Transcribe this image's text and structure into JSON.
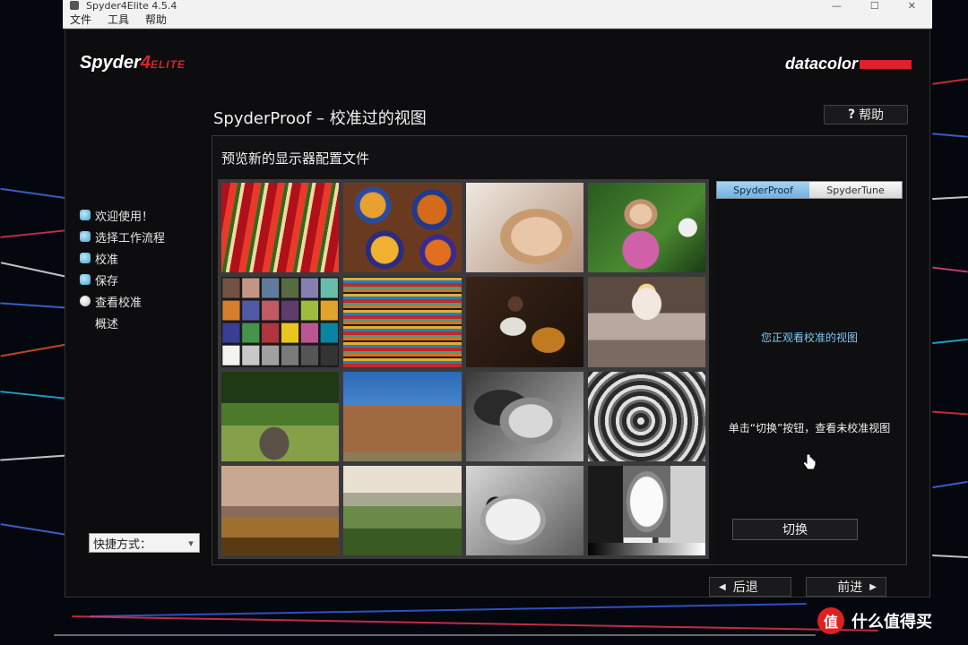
{
  "os": {
    "title": "Spyder4Elite 4.5.4",
    "menu": [
      "文件",
      "工具",
      "帮助"
    ]
  },
  "brand": {
    "product_main": "Spyder",
    "product_num": "4",
    "product_edition": "ELITE",
    "vendor": "datacolor"
  },
  "header": {
    "title": "SpyderProof – 校准过的视图",
    "help_label": "帮助"
  },
  "nav": {
    "items": [
      {
        "label": "欢迎使用！",
        "state": "done"
      },
      {
        "label": "选择工作流程",
        "state": "done"
      },
      {
        "label": "校准",
        "state": "done"
      },
      {
        "label": "保存",
        "state": "done"
      },
      {
        "label": "查看校准",
        "state": "current"
      },
      {
        "label": "概述",
        "state": "none"
      }
    ],
    "shortcut_value": "快捷方式："
  },
  "panel": {
    "title": "预览新的显示器配置文件",
    "tabs": {
      "active": "SpyderProof",
      "inactive": "SpyderTune"
    },
    "status_text": "您正观看校准的视图",
    "hint_text": "单击“切换”按钮，查看未校准视图",
    "toggle_label": "切换"
  },
  "footer": {
    "back_label": "后退",
    "next_label": "前进"
  },
  "watermark": {
    "badge": "值",
    "text": "什么值得买"
  },
  "colors": {
    "accent_red": "#e0202a",
    "link_blue": "#7fc6ef",
    "tab_active": "#8cc4ea"
  },
  "thumbnails": [
    "peppers",
    "painted-plates",
    "woman-face",
    "girl-with-flowers",
    "color-checker",
    "textiles",
    "bass-player",
    "marilyn-scene",
    "garden-urn",
    "adobe-church",
    "bw-portrait",
    "spiral-staircase",
    "sunset-field",
    "tuscan-hills",
    "bw-scooter",
    "bw-gray-target"
  ]
}
